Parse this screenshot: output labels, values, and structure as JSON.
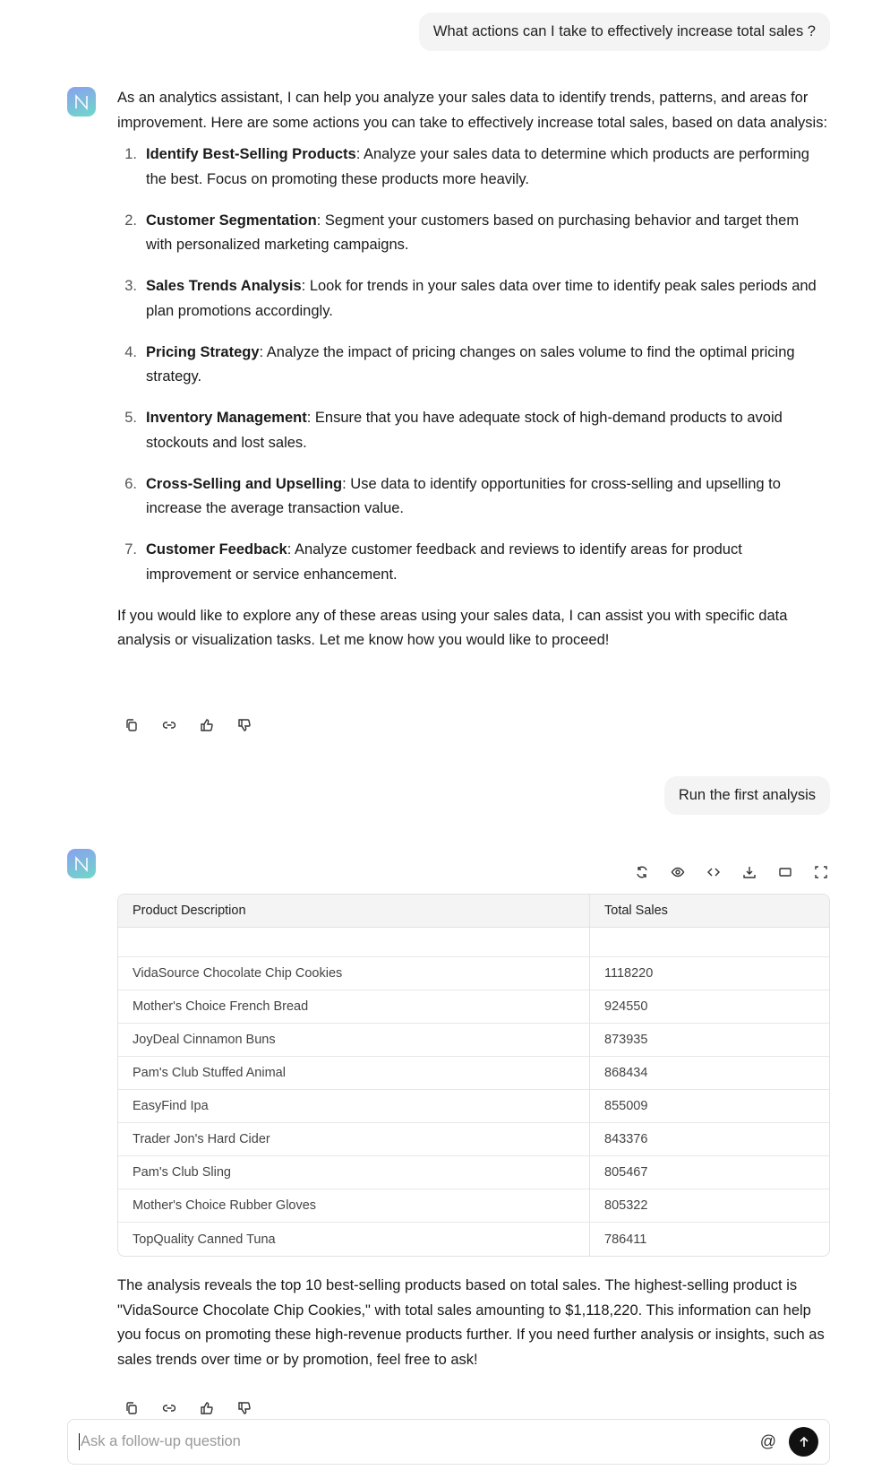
{
  "messages": {
    "user1": "What actions can I take to effectively increase total sales ?",
    "assistant1": {
      "intro": "As an analytics assistant, I can help you analyze your sales data to identify trends, patterns, and areas for improvement. Here are some actions you can take to effectively increase total sales, based on data analysis:",
      "items": [
        {
          "num": "1.",
          "title": "Identify Best-Selling Products",
          "text": ": Analyze your sales data to determine which products are performing the best. Focus on promoting these products more heavily."
        },
        {
          "num": "2.",
          "title": "Customer Segmentation",
          "text": ": Segment your customers based on purchasing behavior and target them with personalized marketing campaigns."
        },
        {
          "num": "3.",
          "title": "Sales Trends Analysis",
          "text": ": Look for trends in your sales data over time to identify peak sales periods and plan promotions accordingly."
        },
        {
          "num": "4.",
          "title": "Pricing Strategy",
          "text": ": Analyze the impact of pricing changes on sales volume to find the optimal pricing strategy."
        },
        {
          "num": "5.",
          "title": "Inventory Management",
          "text": ": Ensure that you have adequate stock of high-demand products to avoid stockouts and lost sales."
        },
        {
          "num": "6.",
          "title": "Cross-Selling and Upselling",
          "text": ": Use data to identify opportunities for cross-selling and upselling to increase the average transaction value."
        },
        {
          "num": "7.",
          "title": "Customer Feedback",
          "text": ": Analyze customer feedback and reviews to identify areas for product improvement or service enhancement."
        }
      ],
      "outro": "If you would like to explore any of these areas using your sales data, I can assist you with specific data analysis or visualization tasks. Let me know how you would like to proceed!"
    },
    "user2": "Run the first analysis",
    "assistant2": {
      "table": {
        "headers": [
          "Product Description",
          "Total Sales"
        ],
        "rows": [
          [
            "",
            ""
          ],
          [
            "VidaSource Chocolate Chip Cookies",
            "1118220"
          ],
          [
            "Mother's Choice French Bread",
            "924550"
          ],
          [
            "JoyDeal Cinnamon Buns",
            "873935"
          ],
          [
            "Pam's Club Stuffed Animal",
            "868434"
          ],
          [
            "EasyFind Ipa",
            "855009"
          ],
          [
            "Trader Jon's Hard Cider",
            "843376"
          ],
          [
            "Pam's Club Sling",
            "805467"
          ],
          [
            "Mother's Choice Rubber Gloves",
            "805322"
          ],
          [
            "TopQuality Canned Tuna",
            "786411"
          ]
        ]
      },
      "summary": "The analysis reveals the top 10 best-selling products based on total sales. The highest-selling product is \"VidaSource Chocolate Chip Cookies,\" with total sales amounting to $1,118,220. This information can help you focus on promoting these high-revenue products further. If you need further analysis or insights, such as sales trends over time or by promotion, feel free to ask!"
    }
  },
  "input": {
    "placeholder": "Ask a follow-up question",
    "value": "",
    "mention": "@"
  }
}
